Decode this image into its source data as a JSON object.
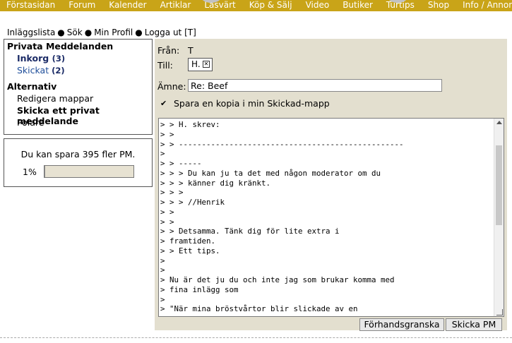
{
  "topnav": {
    "items": [
      "Förstasidan",
      "Forum",
      "Kalender",
      "Artiklar",
      "Läsvärt",
      "Köp & Sälj",
      "Video",
      "Butiker",
      "Turtips",
      "Shop",
      "Info / Annonsera"
    ]
  },
  "userlinks": {
    "posts": "Inläggslista",
    "search": "Sök",
    "profile": "Min Profil",
    "logout": "Logga ut [T]"
  },
  "sidebar": {
    "heading_pm": "Privata Meddelanden",
    "inbox_label": "Inkorg",
    "inbox_count": "(3)",
    "sent_label": "Skickat",
    "sent_count": "(2)",
    "heading_alt": "Alternativ",
    "edit_folders": "Redigera mappar",
    "send_private": "Skicka ett privat meddelande",
    "friends": "Polare"
  },
  "quota": {
    "text": "Du kan spara 395 fler PM.",
    "percent_label": "1%",
    "fill_percent": 1
  },
  "compose": {
    "from_label": "Från:",
    "from_value": "T",
    "to_label": "Till:",
    "to_value": "H.",
    "subject_label": "Ämne:",
    "subject_value": "Re: Beef",
    "save_copy_label": "Spara en kopia i min Skickad-mapp",
    "save_copy_checked": true,
    "body": "> > H. skrev:\n> >\n> > -------------------------------------------------\n>\n> > -----\n> > > Du kan ju ta det med någon moderator om du\n> > > känner dig kränkt.\n> > >\n> > > //Henrik\n> >\n> >\n> > Detsamma. Tänk dig för lite extra i\n> framtiden.\n> > Ett tips.\n>\n>\n> Nu är det ju du och inte jag som brukar komma med\n> fina inlägg som\n>\n> \"När mina bröstvårtor blir slickade av en",
    "preview_button": "Förhandsgranska",
    "send_button": "Skicka PM"
  },
  "colors": {
    "nav_bg": "#c9a418",
    "panel_bg": "#e3dfcf",
    "link_blue": "#1f4e9a",
    "link_navy": "#1b2b66"
  }
}
